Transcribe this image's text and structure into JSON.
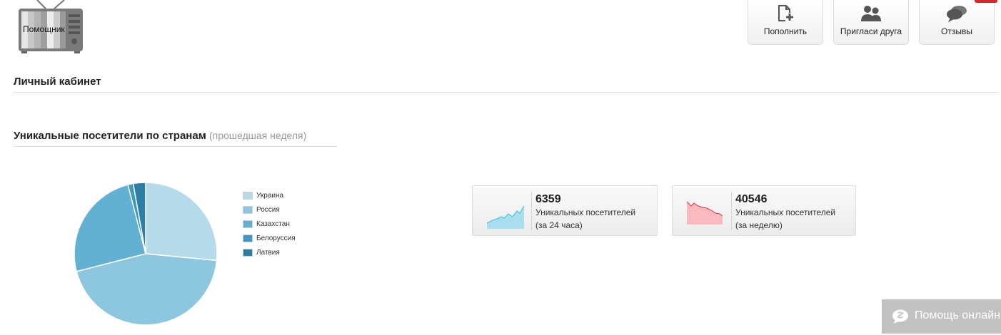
{
  "logo": {
    "label": "Помощник",
    "icon": "tv-icon"
  },
  "top_buttons": [
    {
      "label": "Пополнить",
      "icon": "add-document-icon"
    },
    {
      "label": "Пригласи друга",
      "icon": "users-icon"
    },
    {
      "label": "Отзывы",
      "icon": "chat-bubbles-icon"
    }
  ],
  "page": {
    "title": "Личный кабинет",
    "chart_title": "Уникальные посетители по странам",
    "chart_subtitle": "(прошедшая неделя)"
  },
  "chart_data": {
    "type": "pie",
    "title": "Уникальные посетители по странам",
    "subtitle": "(прошедшая неделя)",
    "legend_position": "right",
    "slices": [
      {
        "label": "Украина",
        "value": 26.5,
        "color": "#b5dbea"
      },
      {
        "label": "Россия",
        "value": 44.5,
        "color": "#8dc6df"
      },
      {
        "label": "Казахстан",
        "value": 25.0,
        "color": "#62b1d3"
      },
      {
        "label": "Белоруссия",
        "value": 1.2,
        "color": "#3f98c2"
      },
      {
        "label": "Латвия",
        "value": 2.8,
        "color": "#2b7fa6"
      }
    ]
  },
  "stats": [
    {
      "value": "6359",
      "line1": "Уникальных посетителей",
      "line2": "(за 24 часа)",
      "trend": "up",
      "color": "#39bde0",
      "fill": "#a9def0"
    },
    {
      "value": "40546",
      "line1": "Уникальных посетителей",
      "line2": "(за неделю)",
      "trend": "down",
      "color": "#e8303d",
      "fill": "#fbb9c0"
    }
  ],
  "help": {
    "label": "Помощь онлайн",
    "icon": "chat-icon"
  },
  "colors": {
    "badge": "#d9262b",
    "help_bg": "#c2c2c2"
  }
}
